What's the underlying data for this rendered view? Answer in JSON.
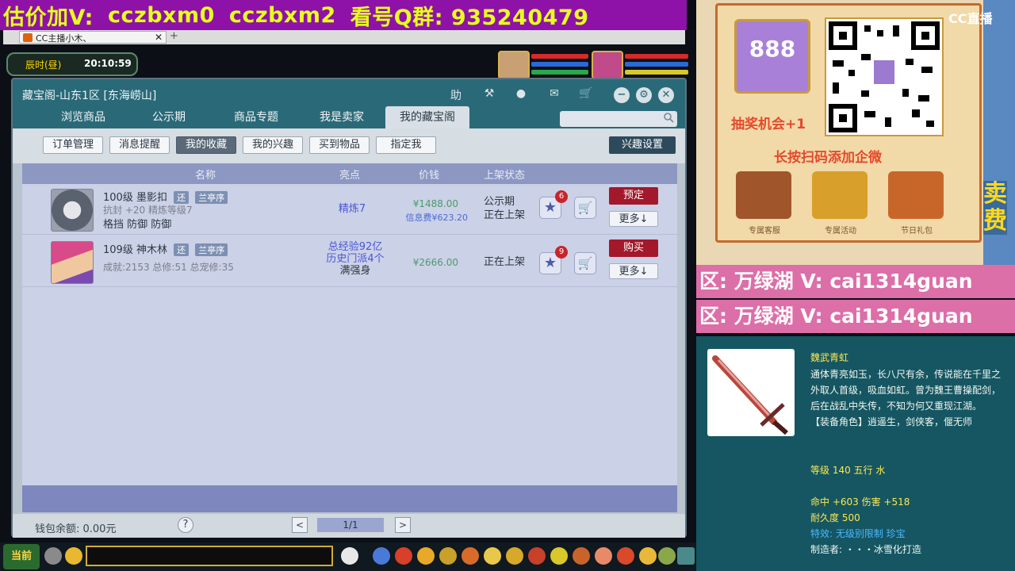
{
  "banner": {
    "text1": "估价加V:",
    "text2": "cczbxm0",
    "text3": "cczbxm2",
    "text4": "看号Q群: 935240479"
  },
  "browser": {
    "tab_label": "CC主播小木、"
  },
  "game": {
    "time_day": "辰时(昼)",
    "time_clock": "20:10:59"
  },
  "dialog": {
    "title": "藏宝阁-山东1区 [东海崂山]",
    "help_label": "助",
    "tabs": [
      "浏览商品",
      "公示期",
      "商品专题",
      "我是卖家",
      "我的藏宝阁"
    ],
    "subtabs": [
      "订单管理",
      "消息提醒",
      "我的收藏",
      "我的兴趣",
      "买到物品",
      "指定我"
    ],
    "interest_btn": "兴趣设置",
    "headers": [
      "名称",
      "亮点",
      "价钱",
      "上架状态"
    ],
    "rows": [
      {
        "name": "100级 墨影扣",
        "badge1": "还",
        "badge2": "兰亭序",
        "line1": "抗封 +20 精炼等级7",
        "line2": "格挡 防御 防御",
        "highlight1": "精炼7",
        "highlight2": "",
        "highlight3": "",
        "price": "¥1488.00",
        "price_note": "信息费¥623.20",
        "status1": "公示期",
        "status2": "正在上架",
        "star_count": "6",
        "action": "预定",
        "more": "更多↓"
      },
      {
        "name": "109级 神木林",
        "badge1": "还",
        "badge2": "兰亭序",
        "line1": "成就:2153 总修:51 总宠修:35",
        "line2": "",
        "highlight1": "总经验92亿",
        "highlight2": "历史门派4个",
        "highlight3": "满强身",
        "price": "¥2666.00",
        "price_note": "",
        "status1": "正在上架",
        "status2": "",
        "star_count": "9",
        "action": "购买",
        "more": "更多↓"
      }
    ],
    "balance": "钱包余额: 0.00元",
    "help_q": "?",
    "pager": "1/1"
  },
  "bottombar": {
    "channel": "当前"
  },
  "side": {
    "promo_number": "888",
    "lottery": "抽奖机会+1",
    "scan_hint": "长按扫码添加企微",
    "perks": [
      "专属客服",
      "专属活动",
      "节日礼包"
    ],
    "cc_logo": "CC直播",
    "sell": "卖费",
    "streak1": "区: 万绿湖 V: cai1314guan",
    "streak2": "区: 万绿湖 V: cai1314guan"
  },
  "tooltip": {
    "name": "魏武青虹",
    "desc": "通体青亮如玉，长八尺有余，传说能在千里之外取人首级，吸血如虹。曾为魏王曹操配剑，后在战乱中失传，不知为何又重现江湖。",
    "role": "【装备角色】逍遥生，剑侠客，偃无师",
    "level": "等级 140 五行 水",
    "stats": "命中 +603 伤害 +518",
    "durability": "耐久度 500",
    "effect": "特效: 无级别限制 珍宝",
    "maker": "制造者: ・・・冰雪化打造"
  },
  "colors": {
    "banner_bg": "#8e12a8",
    "banner_text": "#e6ff1e",
    "dialog_head": "#2a6a78",
    "red_btn": "#a3182a",
    "streak": "#dc6ea8",
    "tooltip_bg": "#155662"
  }
}
